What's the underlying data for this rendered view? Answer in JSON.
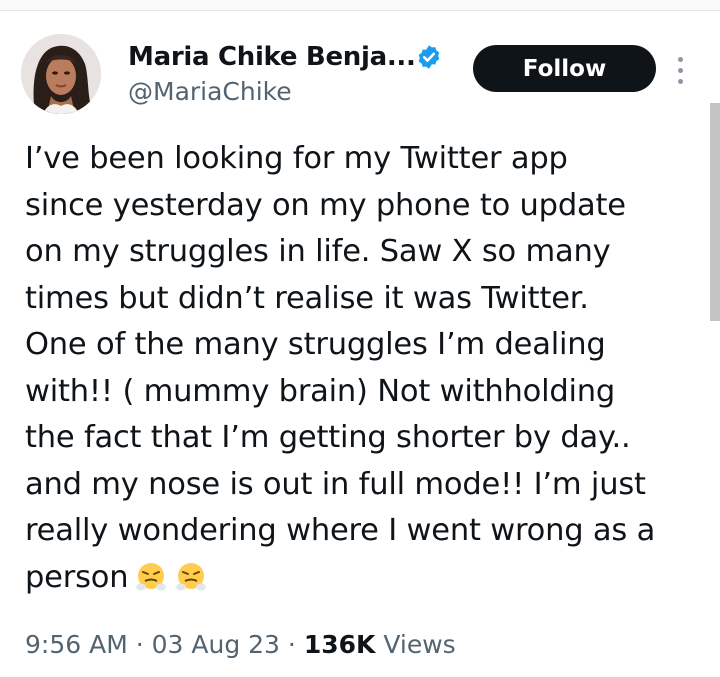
{
  "author": {
    "name": "Maria Chike Benja...",
    "handle": "@MariaChike",
    "verified": true
  },
  "actions": {
    "follow_label": "Follow",
    "more_icon": "more-vertical-icon"
  },
  "tweet": {
    "lines": [
      "I’ve been looking for my Twitter app",
      "since yesterday on my phone to update",
      "on my struggles in life. Saw X so many",
      "times but didn’t realise it was Twitter.",
      "One of the many struggles I’m dealing",
      "with!! ( mummy brain) Not withholding",
      "the fact that I’m getting shorter by day..",
      "and my nose is out in full mode!! I’m just",
      "really wondering where I went wrong as a",
      "person"
    ],
    "emojis": [
      "😤",
      "😤"
    ]
  },
  "meta": {
    "time": "9:56 AM",
    "separator": "·",
    "date": "03 Aug 23",
    "views_count": "136K",
    "views_label": "Views"
  },
  "colors": {
    "text": "#0f1419",
    "secondary": "#536471",
    "verified": "#1d9bf0",
    "follow_bg": "#0f1419",
    "emoji": "#ffcc4d"
  }
}
